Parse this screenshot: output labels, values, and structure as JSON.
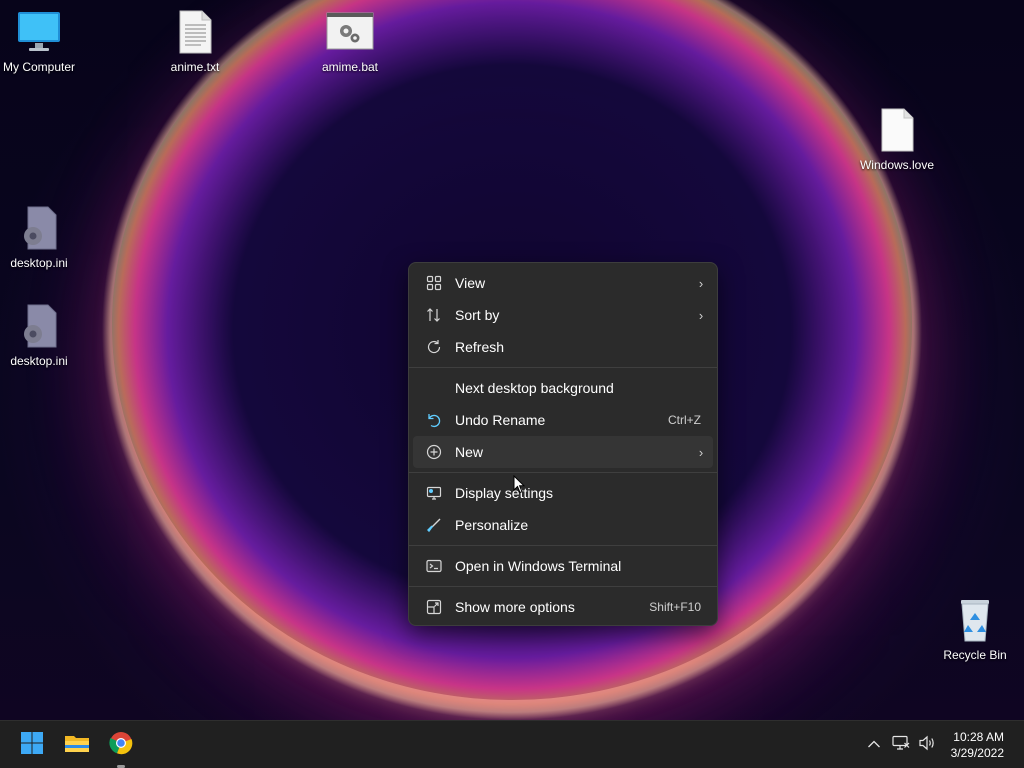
{
  "desktop": {
    "icons": [
      {
        "label": "My Computer",
        "icon": "monitor-icon"
      },
      {
        "label": "anime.txt",
        "icon": "text-file-icon"
      },
      {
        "label": "amime.bat",
        "icon": "batch-file-icon"
      },
      {
        "label": "Windows.love",
        "icon": "blank-file-icon"
      },
      {
        "label": "desktop.ini",
        "icon": "settings-file-icon"
      },
      {
        "label": "desktop.ini",
        "icon": "settings-file-icon"
      },
      {
        "label": "Recycle Bin",
        "icon": "recycle-bin-icon"
      }
    ]
  },
  "context_menu": {
    "items": [
      {
        "label": "View",
        "icon": "grid-icon",
        "submenu": true
      },
      {
        "label": "Sort by",
        "icon": "sort-icon",
        "submenu": true
      },
      {
        "label": "Refresh",
        "icon": "refresh-icon"
      },
      {
        "label": "Next desktop background"
      },
      {
        "label": "Undo Rename",
        "icon": "undo-icon",
        "shortcut": "Ctrl+Z"
      },
      {
        "label": "New",
        "icon": "plus-circle-icon",
        "submenu": true
      },
      {
        "label": "Display settings",
        "icon": "display-settings-icon"
      },
      {
        "label": "Personalize",
        "icon": "brush-icon"
      },
      {
        "label": "Open in Windows Terminal",
        "icon": "terminal-icon"
      },
      {
        "label": "Show more options",
        "icon": "more-options-icon",
        "shortcut": "Shift+F10"
      }
    ]
  },
  "taskbar": {
    "apps": [
      {
        "name": "Start",
        "icon": "windows-start-icon"
      },
      {
        "name": "File Explorer",
        "icon": "folder-icon"
      },
      {
        "name": "Google Chrome",
        "icon": "chrome-icon"
      }
    ],
    "tray": {
      "chevron_icon": "chevron-up-icon",
      "network_icon": "network-icon",
      "volume_icon": "volume-icon"
    },
    "clock": {
      "time": "10:28 AM",
      "date": "3/29/2022"
    }
  },
  "colors": {
    "menu_bg": "#2b2b2b",
    "taskbar_bg": "#202020",
    "accent": "#60cdff"
  }
}
